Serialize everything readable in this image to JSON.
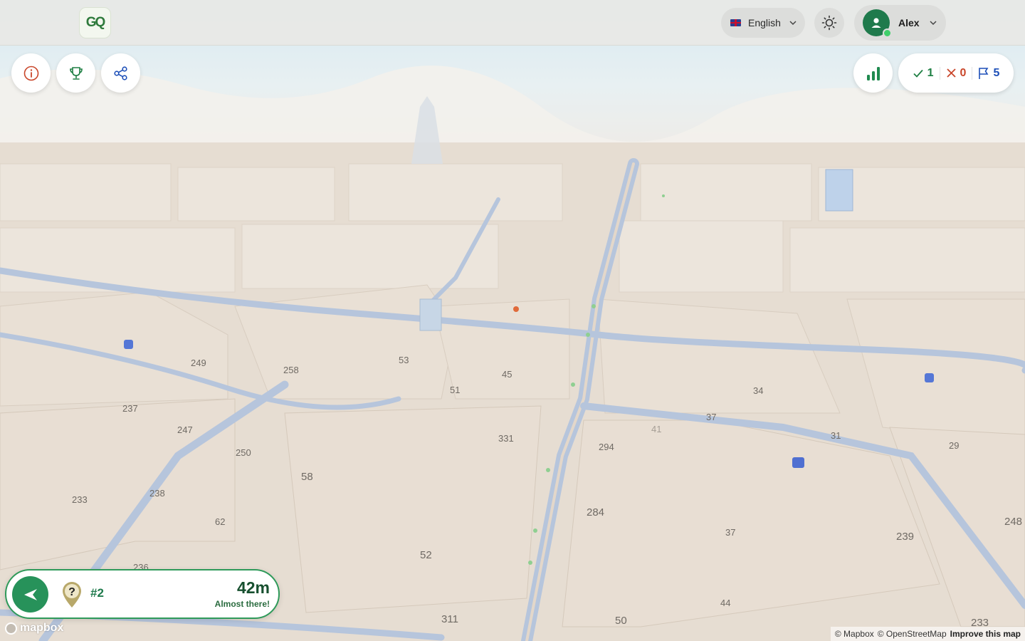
{
  "header": {
    "logo_text": "GQ",
    "language": {
      "flag": "uk-flag-icon",
      "label": "English"
    },
    "theme_icon": "sun-icon",
    "user": {
      "name": "Alex",
      "status": "online"
    }
  },
  "controls": {
    "info_icon": "info-icon",
    "leaderboard_icon": "trophy-icon",
    "share_icon": "share-icon",
    "stats_icon": "bar-chart-icon"
  },
  "score": {
    "correct": "1",
    "wrong": "0",
    "flags": "5"
  },
  "navigation": {
    "round": "#2",
    "distance": "42m",
    "hint": "Almost there!"
  },
  "map": {
    "labels": [
      "249",
      "258",
      "53",
      "45",
      "51",
      "34",
      "237",
      "247",
      "250",
      "58",
      "331",
      "37",
      "31",
      "29",
      "294",
      "41",
      "238",
      "233",
      "62",
      "284",
      "37",
      "239",
      "248",
      "52",
      "236",
      "44",
      "50",
      "311",
      "233"
    ],
    "watermark": "mapbox",
    "attribution": [
      "© Mapbox",
      "© OpenStreetMap",
      "Improve this map"
    ]
  },
  "colors": {
    "accent": "#27925a",
    "correct": "#1e7f43",
    "wrong": "#c9462a",
    "flag": "#1d4fb8",
    "road": "#aebfd8",
    "building": "#e9e0d6"
  }
}
